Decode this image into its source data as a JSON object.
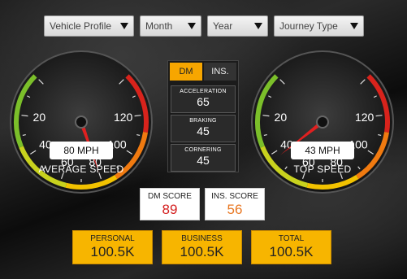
{
  "filters": [
    {
      "label": "Vehicle Profile"
    },
    {
      "label": "Month"
    },
    {
      "label": "Year"
    },
    {
      "label": "Journey Type"
    }
  ],
  "gauges": [
    {
      "label": "AVERAGE SPEED",
      "readout": "80 MPH",
      "value": 80,
      "max": 140,
      "ticks": [
        "20",
        "40",
        "60",
        "80",
        "100",
        "120"
      ]
    },
    {
      "label": "TOP SPEED",
      "readout": "43 MPH",
      "value": 43,
      "max": 140,
      "ticks": [
        "20",
        "40",
        "60",
        "80",
        "100",
        "120"
      ]
    }
  ],
  "panel": {
    "tabs": [
      {
        "label": "DM",
        "active": true
      },
      {
        "label": "INS.",
        "active": false
      }
    ],
    "stats": [
      {
        "label": "ACCELERATION",
        "value": "65"
      },
      {
        "label": "BRAKING",
        "value": "45"
      },
      {
        "label": "CORNERING",
        "value": "45"
      }
    ]
  },
  "scores": {
    "dm": {
      "label": "DM SCORE",
      "value": "89",
      "color": "#d42020"
    },
    "ins": {
      "label": "INS. SCORE",
      "value": "56",
      "color": "#e87722"
    }
  },
  "totals": [
    {
      "label": "PERSONAL",
      "value": "100.5K"
    },
    {
      "label": "BUSINESS",
      "value": "100.5K"
    },
    {
      "label": "TOTAL",
      "value": "100.5K"
    }
  ],
  "colors": {
    "accent": "#f7b500",
    "needle": "#e02020"
  }
}
